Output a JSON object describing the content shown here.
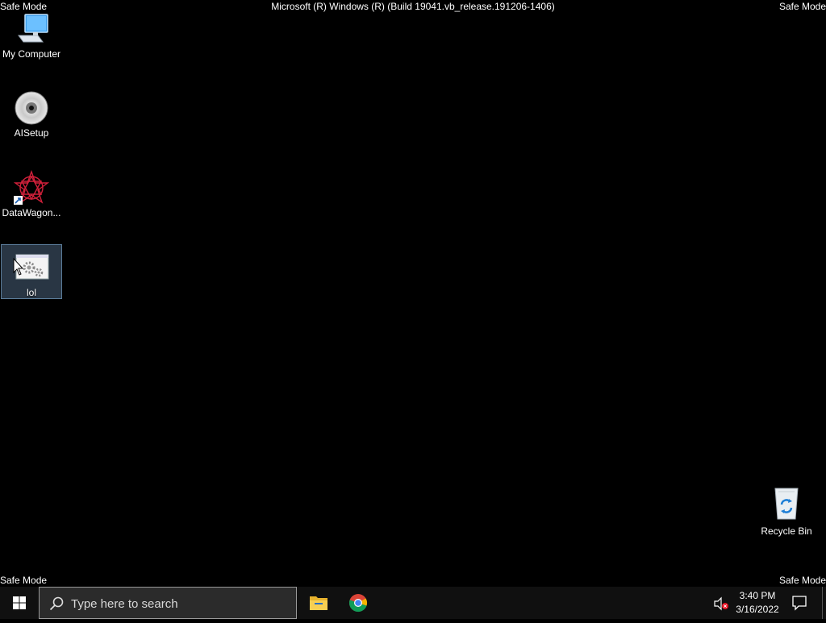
{
  "overlay": {
    "safe_mode": "Safe Mode",
    "build_title": "Microsoft (R) Windows (R) (Build 19041.vb_release.191206-1406)"
  },
  "desktop_icons": [
    {
      "label": "My Computer",
      "icon": "computer-icon"
    },
    {
      "label": "AISetup",
      "icon": "disc-icon"
    },
    {
      "label": "DataWagon...",
      "icon": "datawagon-shortcut-icon"
    },
    {
      "label": "lol",
      "icon": "settings-window-icon",
      "selected": true
    },
    {
      "label": "Recycle Bin",
      "icon": "recycle-bin-icon"
    }
  ],
  "taskbar": {
    "start_icon": "windows-start-icon",
    "search_placeholder": "Type here to search",
    "pinned": [
      "file-explorer-icon",
      "chrome-icon"
    ],
    "tray": {
      "sound_icon": "speaker-muted-icon",
      "time": "3:40 PM",
      "date": "3/16/2022",
      "notification_icon": "action-center-icon"
    }
  },
  "colors": {
    "desktop_bg": "#000000",
    "taskbar_bg": "#101010",
    "selection": "#5b7c99"
  }
}
